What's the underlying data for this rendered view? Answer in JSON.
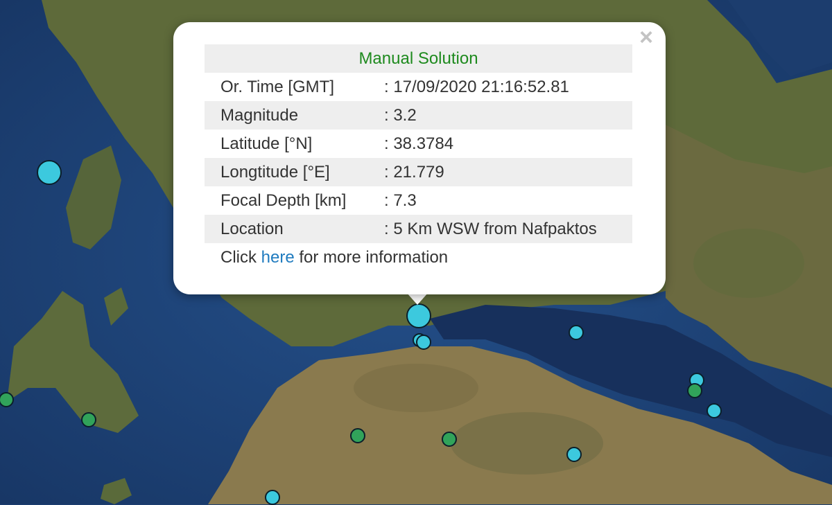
{
  "popup": {
    "title": "Manual Solution",
    "close_glyph": "×",
    "rows": [
      {
        "label": "Or. Time [GMT]",
        "value": ": 17/09/2020 21:16:52.81"
      },
      {
        "label": "Magnitude",
        "value": ": 3.2"
      },
      {
        "label": "Latitude [°N]",
        "value": ": 38.3784"
      },
      {
        "label": "Longtitude [°E]",
        "value": ": 21.779"
      },
      {
        "label": "Focal Depth [km]",
        "value": ": 7.3"
      },
      {
        "label": "Location",
        "value": ": 5 Km WSW from Nafpaktos"
      }
    ],
    "footer": {
      "prefix": "Click ",
      "link_text": "here",
      "suffix": " for more information"
    },
    "colors": {
      "title": "#1e8a1e",
      "link": "#1f7bbf"
    }
  },
  "markers": {
    "cyan_color": "#3cc9de",
    "green_color": "#31a35a"
  }
}
